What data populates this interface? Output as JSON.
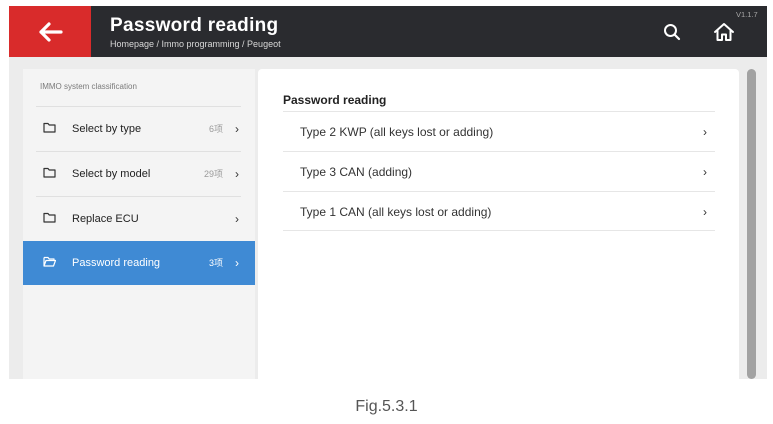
{
  "header": {
    "title": "Password reading",
    "breadcrumb": "Homepage / Immo programming / Peugeot",
    "version": "V1.1.7",
    "back_icon": "arrow-left-icon",
    "search_icon": "search-icon",
    "home_icon": "home-icon"
  },
  "colors": {
    "header_bg": "#2a2b2f",
    "back_bg": "#d92b2b",
    "active_bg": "#3f8ad4"
  },
  "sidebar": {
    "heading": "IMMO system classification",
    "items": [
      {
        "label": "Select by type",
        "count": "6项",
        "icon": "folder-icon",
        "active": false
      },
      {
        "label": "Select by model",
        "count": "29项",
        "icon": "folder-icon",
        "active": false
      },
      {
        "label": "Replace ECU",
        "count": "",
        "icon": "folder-icon",
        "active": false
      },
      {
        "label": "Password reading",
        "count": "3项",
        "icon": "folder-open-icon",
        "active": true
      }
    ]
  },
  "main": {
    "heading": "Password reading",
    "items": [
      {
        "label": "Type 2 KWP (all keys lost or adding)"
      },
      {
        "label": "Type 3 CAN (adding)"
      },
      {
        "label": "Type 1 CAN (all keys lost or adding)"
      }
    ]
  },
  "caption": "Fig.5.3.1"
}
